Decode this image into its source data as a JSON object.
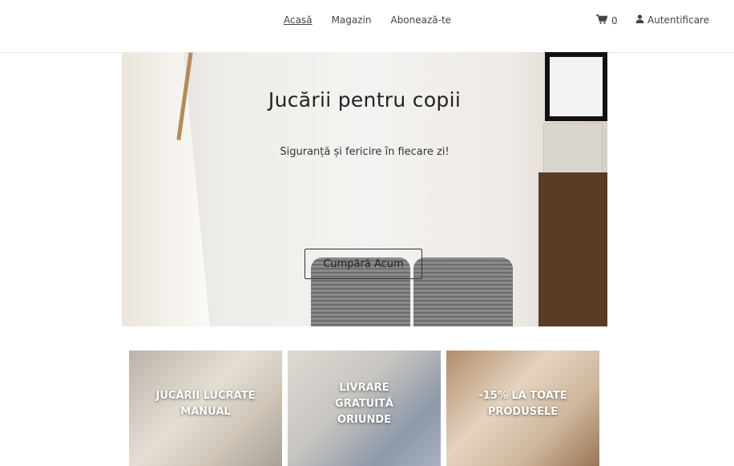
{
  "nav": {
    "items": [
      {
        "label": "Acasă"
      },
      {
        "label": "Magazin"
      },
      {
        "label": "Abonează-te"
      }
    ]
  },
  "cart": {
    "count": "0",
    "icon": "cart-icon"
  },
  "account": {
    "label": "Autentificare",
    "icon": "user-icon"
  },
  "hero": {
    "title": "Jucării pentru copii",
    "subtitle": "Siguranță și fericire în fiecare zi!",
    "button_label": "Cumpără Acum"
  },
  "promos": [
    {
      "lines": [
        "JUCĂRII LUCRATE",
        "MANUAL"
      ]
    },
    {
      "lines": [
        "LIVRARE",
        "GRATUITĂ",
        "ORIUNDE"
      ]
    },
    {
      "lines": [
        "-15% LA TOATE",
        "PRODUSELE"
      ]
    }
  ]
}
